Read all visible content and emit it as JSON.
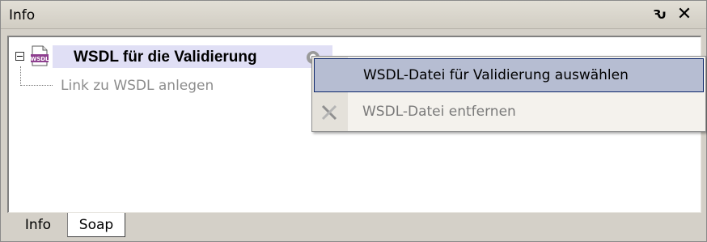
{
  "window": {
    "title": "Info",
    "pin_symbol": "Ԅ",
    "close_symbol": "✕"
  },
  "tree": {
    "root": {
      "label": "WSDL für die Validierung",
      "icon": "wsdl-file-icon",
      "expanded": true,
      "action_icon": "circle-button-icon"
    },
    "child": {
      "label": "Link zu WSDL anlegen"
    }
  },
  "context_menu": {
    "items": [
      {
        "label": "WSDL-Datei für Validierung auswählen",
        "state": "highlighted"
      },
      {
        "label": "WSDL-Datei entfernen",
        "state": "disabled",
        "icon": "delete-x-icon"
      }
    ]
  },
  "tabs": [
    {
      "label": "Info"
    },
    {
      "label": "Soap"
    }
  ],
  "colors": {
    "panel_bg": "#d4d0c8",
    "menu_highlight": "#b6bdd2",
    "menu_highlight_border": "#0a246a",
    "node_highlight": "#e0dff5"
  }
}
